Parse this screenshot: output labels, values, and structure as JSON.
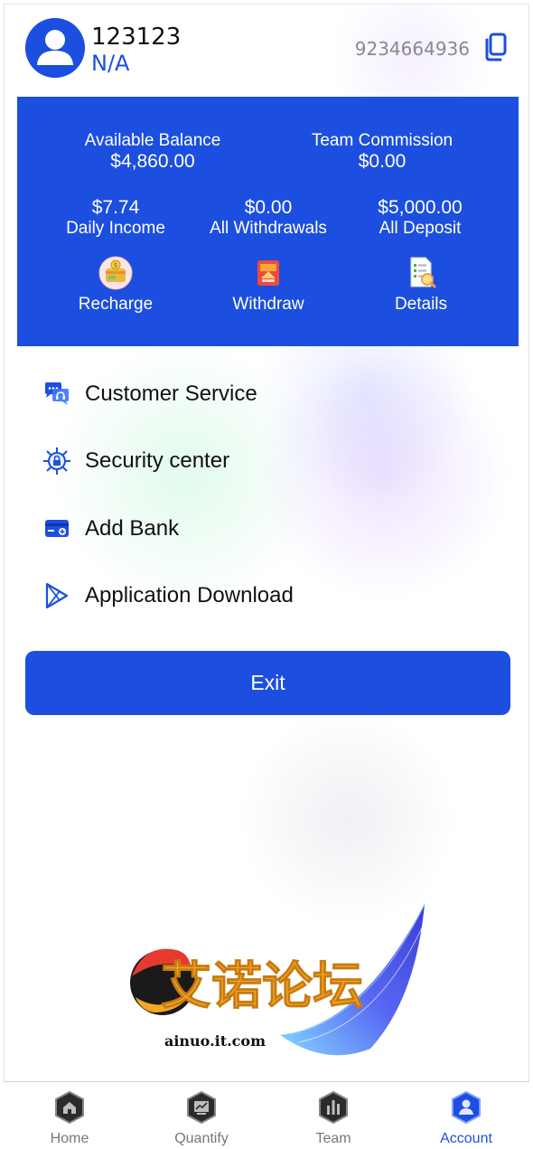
{
  "user": {
    "name": "123123",
    "sub": "N/A",
    "phone": "9234664936"
  },
  "balance": {
    "available_label": "Available Balance",
    "available_value": "$4,860.00",
    "commission_label": "Team Commission",
    "commission_value": "$0.00",
    "daily_value": "$7.74",
    "daily_label": "Daily Income",
    "withdrawals_value": "$0.00",
    "withdrawals_label": "All Withdrawals",
    "deposit_value": "$5,000.00",
    "deposit_label": "All Deposit"
  },
  "actions": {
    "recharge": "Recharge",
    "withdraw": "Withdraw",
    "details": "Details"
  },
  "menu": [
    {
      "label": "Customer Service",
      "icon": "chat-support-icon"
    },
    {
      "label": "Security center",
      "icon": "shield-lock-icon"
    },
    {
      "label": "Add Bank",
      "icon": "bank-card-icon"
    },
    {
      "label": "Application Download",
      "icon": "play-store-icon"
    }
  ],
  "exit_label": "Exit",
  "watermark": {
    "title": "艾诺论坛",
    "domain": "ainuo.it.com"
  },
  "nav": [
    {
      "label": "Home",
      "icon": "home-icon"
    },
    {
      "label": "Quantify",
      "icon": "chart-icon"
    },
    {
      "label": "Team",
      "icon": "team-bars-icon"
    },
    {
      "label": "Account",
      "icon": "account-icon",
      "active": true
    }
  ],
  "colors": {
    "primary": "#1c4fe0",
    "muted": "#8a8a8a"
  }
}
